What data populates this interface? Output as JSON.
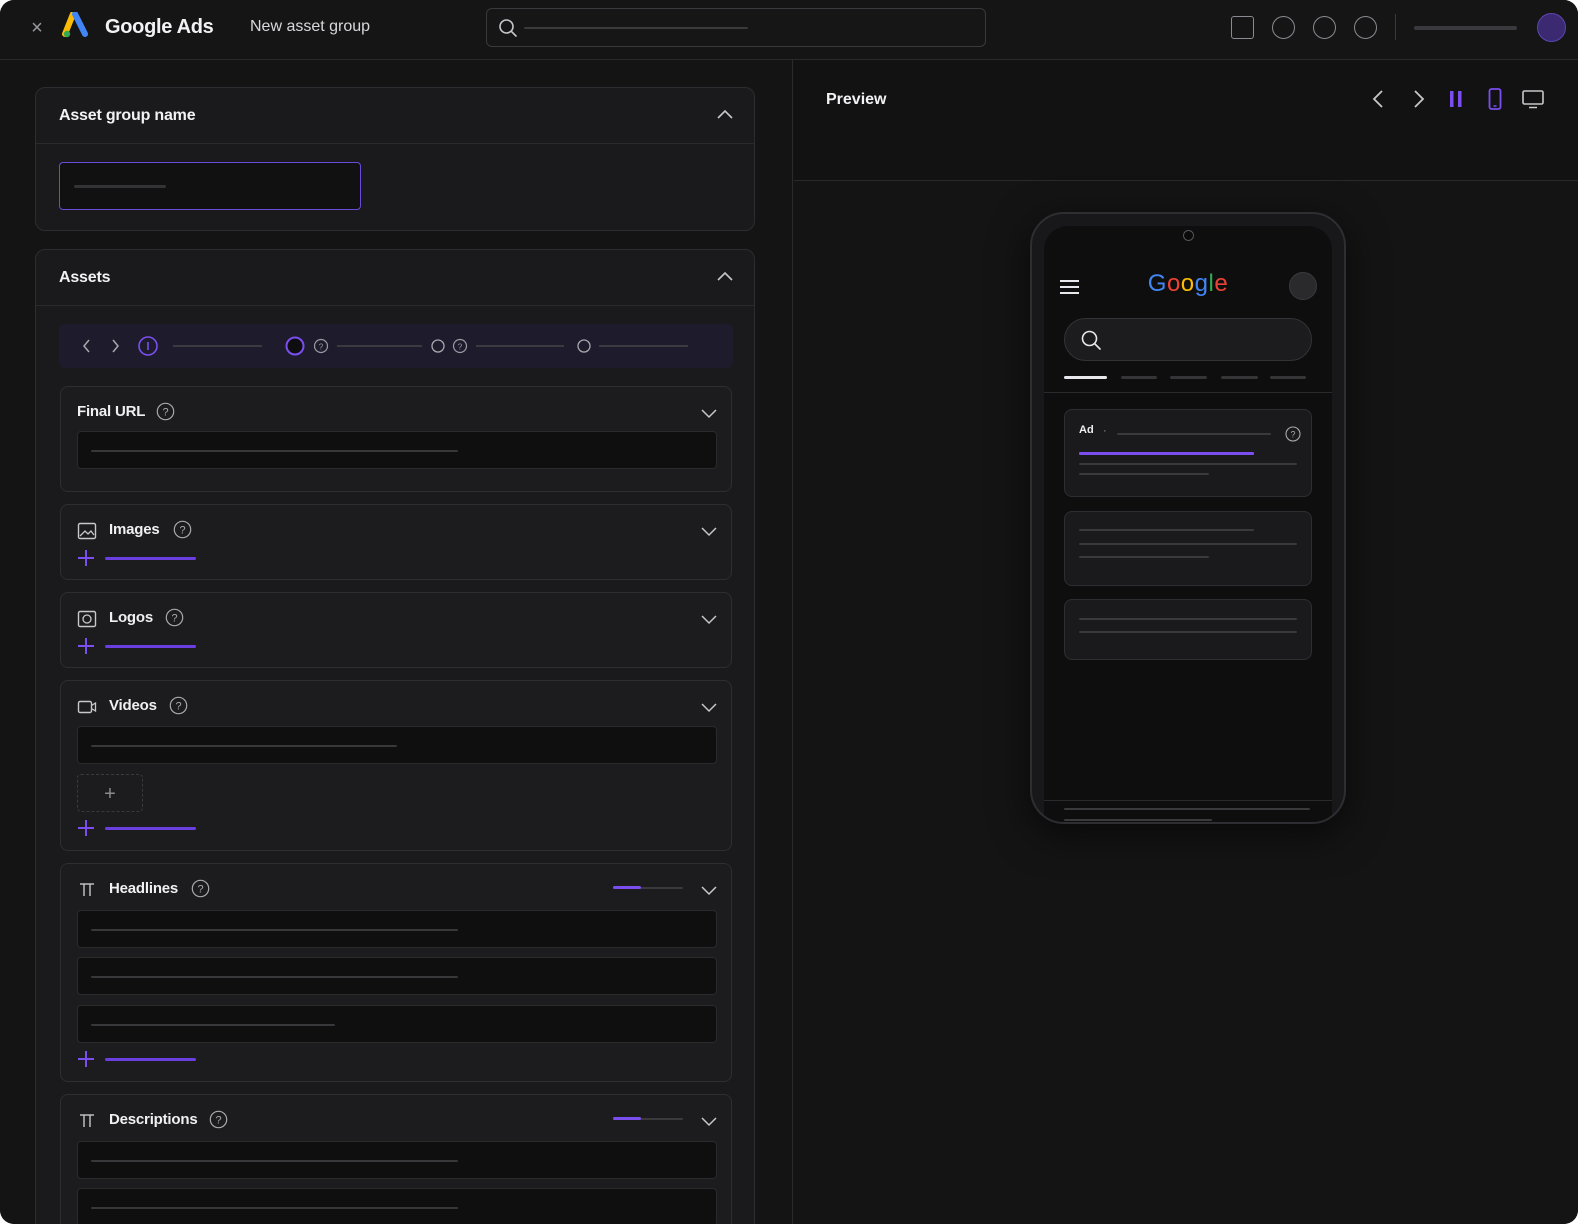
{
  "topbar": {
    "close_icon": "×",
    "app_title": "Google Ads",
    "page_title": "New asset group"
  },
  "left": {
    "asset_group_card": {
      "title": "Asset group name"
    },
    "assets_card": {
      "title": "Assets",
      "sections": [
        {
          "label": "Final URL",
          "icon": "none"
        },
        {
          "label": "Images",
          "icon": "image-icon"
        },
        {
          "label": "Logos",
          "icon": "logo-icon"
        },
        {
          "label": "Videos",
          "icon": "video-icon"
        },
        {
          "label": "Headlines",
          "icon": "text-icon"
        },
        {
          "label": "Descriptions",
          "icon": "text-icon"
        }
      ],
      "video_add_glyph": "+",
      "headlines_strength": 0.4,
      "descriptions_strength": 0.4
    }
  },
  "preview": {
    "title": "Preview",
    "google_logo": [
      "G",
      "o",
      "o",
      "g",
      "l",
      "e"
    ],
    "google_colors": [
      "#4285F4",
      "#EA4335",
      "#FBBC05",
      "#4285F4",
      "#34A853",
      "#EA4335"
    ],
    "ad_label": "Ad",
    "ad_dot": "·"
  },
  "colors": {
    "accent": "#6b3ee0",
    "background": "#141415"
  }
}
